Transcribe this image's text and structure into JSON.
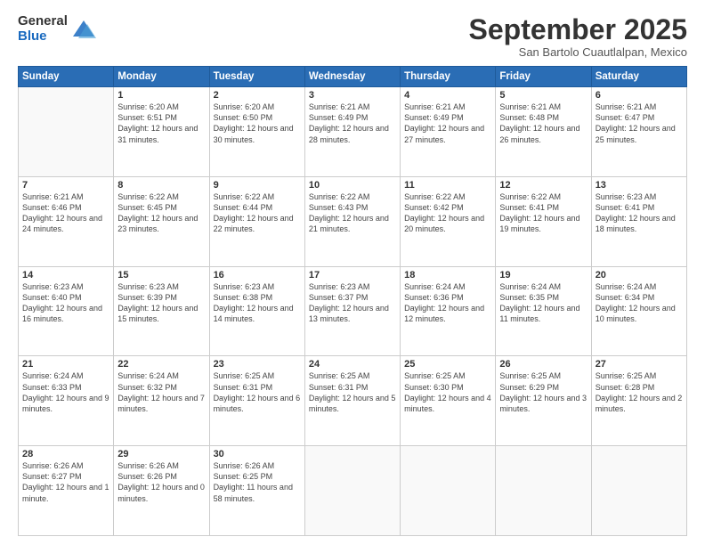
{
  "logo": {
    "general": "General",
    "blue": "Blue"
  },
  "header": {
    "month": "September 2025",
    "location": "San Bartolo Cuautlalpan, Mexico"
  },
  "weekdays": [
    "Sunday",
    "Monday",
    "Tuesday",
    "Wednesday",
    "Thursday",
    "Friday",
    "Saturday"
  ],
  "weeks": [
    [
      {
        "day": "",
        "sunrise": "",
        "sunset": "",
        "daylight": ""
      },
      {
        "day": "1",
        "sunrise": "Sunrise: 6:20 AM",
        "sunset": "Sunset: 6:51 PM",
        "daylight": "Daylight: 12 hours and 31 minutes."
      },
      {
        "day": "2",
        "sunrise": "Sunrise: 6:20 AM",
        "sunset": "Sunset: 6:50 PM",
        "daylight": "Daylight: 12 hours and 30 minutes."
      },
      {
        "day": "3",
        "sunrise": "Sunrise: 6:21 AM",
        "sunset": "Sunset: 6:49 PM",
        "daylight": "Daylight: 12 hours and 28 minutes."
      },
      {
        "day": "4",
        "sunrise": "Sunrise: 6:21 AM",
        "sunset": "Sunset: 6:49 PM",
        "daylight": "Daylight: 12 hours and 27 minutes."
      },
      {
        "day": "5",
        "sunrise": "Sunrise: 6:21 AM",
        "sunset": "Sunset: 6:48 PM",
        "daylight": "Daylight: 12 hours and 26 minutes."
      },
      {
        "day": "6",
        "sunrise": "Sunrise: 6:21 AM",
        "sunset": "Sunset: 6:47 PM",
        "daylight": "Daylight: 12 hours and 25 minutes."
      }
    ],
    [
      {
        "day": "7",
        "sunrise": "Sunrise: 6:21 AM",
        "sunset": "Sunset: 6:46 PM",
        "daylight": "Daylight: 12 hours and 24 minutes."
      },
      {
        "day": "8",
        "sunrise": "Sunrise: 6:22 AM",
        "sunset": "Sunset: 6:45 PM",
        "daylight": "Daylight: 12 hours and 23 minutes."
      },
      {
        "day": "9",
        "sunrise": "Sunrise: 6:22 AM",
        "sunset": "Sunset: 6:44 PM",
        "daylight": "Daylight: 12 hours and 22 minutes."
      },
      {
        "day": "10",
        "sunrise": "Sunrise: 6:22 AM",
        "sunset": "Sunset: 6:43 PM",
        "daylight": "Daylight: 12 hours and 21 minutes."
      },
      {
        "day": "11",
        "sunrise": "Sunrise: 6:22 AM",
        "sunset": "Sunset: 6:42 PM",
        "daylight": "Daylight: 12 hours and 20 minutes."
      },
      {
        "day": "12",
        "sunrise": "Sunrise: 6:22 AM",
        "sunset": "Sunset: 6:41 PM",
        "daylight": "Daylight: 12 hours and 19 minutes."
      },
      {
        "day": "13",
        "sunrise": "Sunrise: 6:23 AM",
        "sunset": "Sunset: 6:41 PM",
        "daylight": "Daylight: 12 hours and 18 minutes."
      }
    ],
    [
      {
        "day": "14",
        "sunrise": "Sunrise: 6:23 AM",
        "sunset": "Sunset: 6:40 PM",
        "daylight": "Daylight: 12 hours and 16 minutes."
      },
      {
        "day": "15",
        "sunrise": "Sunrise: 6:23 AM",
        "sunset": "Sunset: 6:39 PM",
        "daylight": "Daylight: 12 hours and 15 minutes."
      },
      {
        "day": "16",
        "sunrise": "Sunrise: 6:23 AM",
        "sunset": "Sunset: 6:38 PM",
        "daylight": "Daylight: 12 hours and 14 minutes."
      },
      {
        "day": "17",
        "sunrise": "Sunrise: 6:23 AM",
        "sunset": "Sunset: 6:37 PM",
        "daylight": "Daylight: 12 hours and 13 minutes."
      },
      {
        "day": "18",
        "sunrise": "Sunrise: 6:24 AM",
        "sunset": "Sunset: 6:36 PM",
        "daylight": "Daylight: 12 hours and 12 minutes."
      },
      {
        "day": "19",
        "sunrise": "Sunrise: 6:24 AM",
        "sunset": "Sunset: 6:35 PM",
        "daylight": "Daylight: 12 hours and 11 minutes."
      },
      {
        "day": "20",
        "sunrise": "Sunrise: 6:24 AM",
        "sunset": "Sunset: 6:34 PM",
        "daylight": "Daylight: 12 hours and 10 minutes."
      }
    ],
    [
      {
        "day": "21",
        "sunrise": "Sunrise: 6:24 AM",
        "sunset": "Sunset: 6:33 PM",
        "daylight": "Daylight: 12 hours and 9 minutes."
      },
      {
        "day": "22",
        "sunrise": "Sunrise: 6:24 AM",
        "sunset": "Sunset: 6:32 PM",
        "daylight": "Daylight: 12 hours and 7 minutes."
      },
      {
        "day": "23",
        "sunrise": "Sunrise: 6:25 AM",
        "sunset": "Sunset: 6:31 PM",
        "daylight": "Daylight: 12 hours and 6 minutes."
      },
      {
        "day": "24",
        "sunrise": "Sunrise: 6:25 AM",
        "sunset": "Sunset: 6:31 PM",
        "daylight": "Daylight: 12 hours and 5 minutes."
      },
      {
        "day": "25",
        "sunrise": "Sunrise: 6:25 AM",
        "sunset": "Sunset: 6:30 PM",
        "daylight": "Daylight: 12 hours and 4 minutes."
      },
      {
        "day": "26",
        "sunrise": "Sunrise: 6:25 AM",
        "sunset": "Sunset: 6:29 PM",
        "daylight": "Daylight: 12 hours and 3 minutes."
      },
      {
        "day": "27",
        "sunrise": "Sunrise: 6:25 AM",
        "sunset": "Sunset: 6:28 PM",
        "daylight": "Daylight: 12 hours and 2 minutes."
      }
    ],
    [
      {
        "day": "28",
        "sunrise": "Sunrise: 6:26 AM",
        "sunset": "Sunset: 6:27 PM",
        "daylight": "Daylight: 12 hours and 1 minute."
      },
      {
        "day": "29",
        "sunrise": "Sunrise: 6:26 AM",
        "sunset": "Sunset: 6:26 PM",
        "daylight": "Daylight: 12 hours and 0 minutes."
      },
      {
        "day": "30",
        "sunrise": "Sunrise: 6:26 AM",
        "sunset": "Sunset: 6:25 PM",
        "daylight": "Daylight: 11 hours and 58 minutes."
      },
      {
        "day": "",
        "sunrise": "",
        "sunset": "",
        "daylight": ""
      },
      {
        "day": "",
        "sunrise": "",
        "sunset": "",
        "daylight": ""
      },
      {
        "day": "",
        "sunrise": "",
        "sunset": "",
        "daylight": ""
      },
      {
        "day": "",
        "sunrise": "",
        "sunset": "",
        "daylight": ""
      }
    ]
  ]
}
